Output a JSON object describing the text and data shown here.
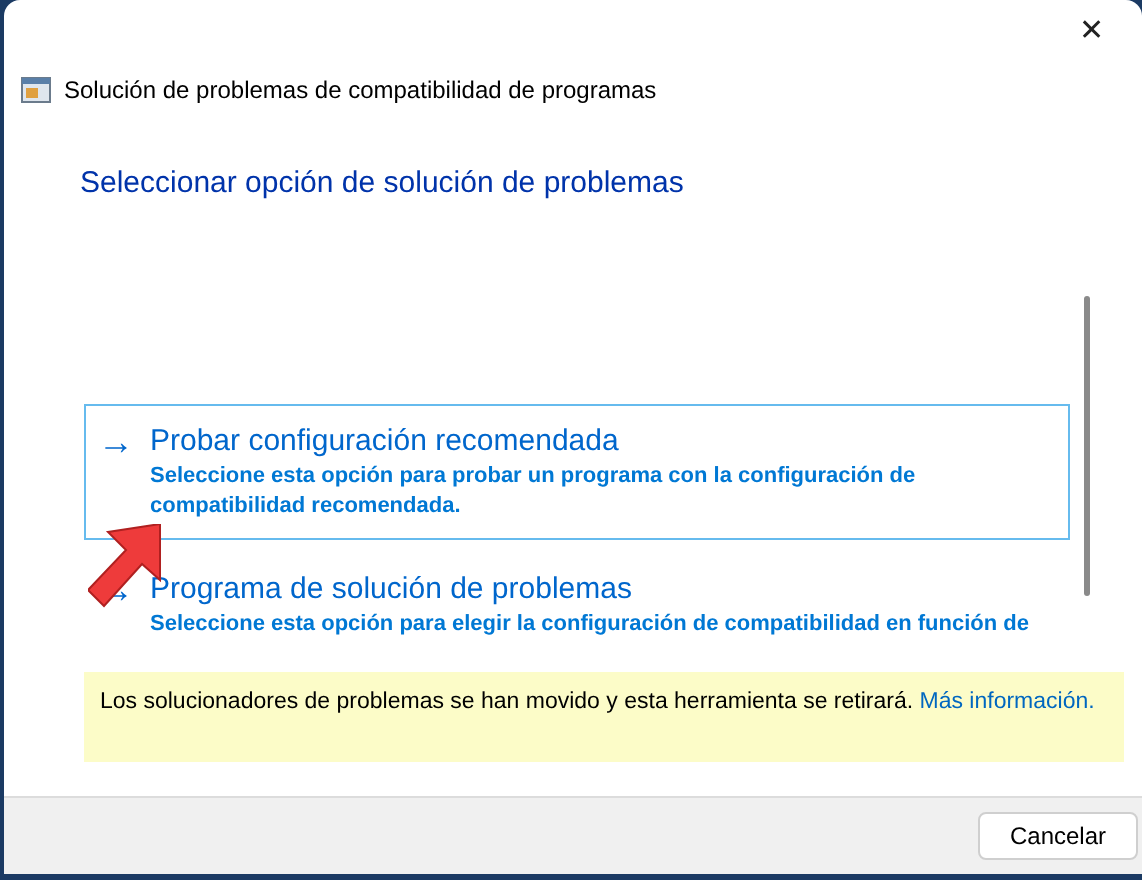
{
  "window": {
    "title": "Solución de problemas de compatibilidad de programas",
    "close": "✕"
  },
  "heading": "Seleccionar opción de solución de problemas",
  "options": [
    {
      "icon": "→",
      "title": "Probar configuración recomendada",
      "description": "Seleccione esta opción para probar un programa con la configuración de compatibilidad recomendada.",
      "selected": true
    },
    {
      "icon": "→",
      "title": "Programa de solución de problemas",
      "description": "Seleccione esta opción para elegir la configuración de compatibilidad en función de",
      "selected": false
    }
  ],
  "notice": {
    "text": "Los solucionadores de problemas se han movido y esta herramienta se retirará.",
    "link": "Más información."
  },
  "buttons": [
    "Cancelar"
  ]
}
